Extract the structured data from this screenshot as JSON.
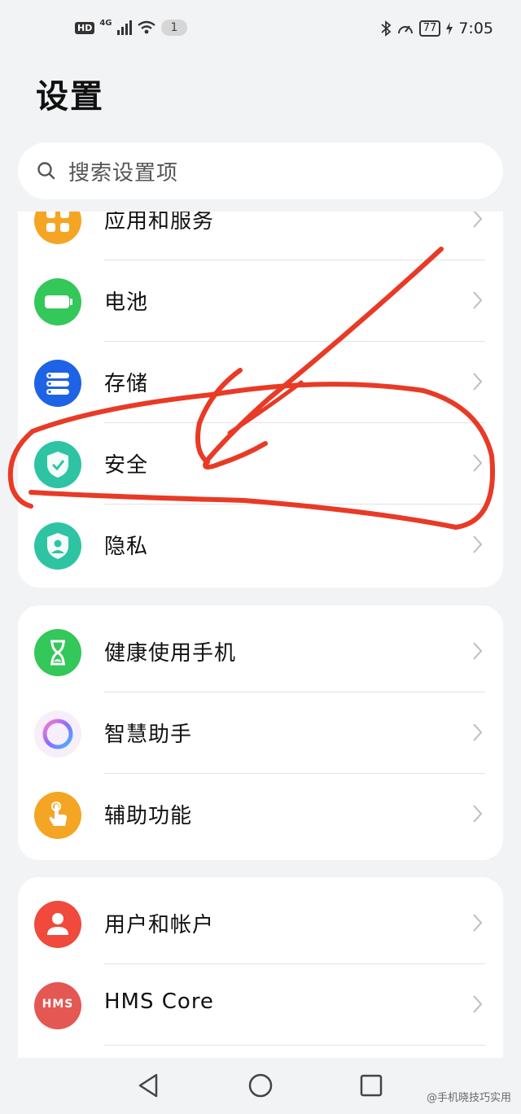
{
  "status_bar": {
    "hd": "HD",
    "network": "4G",
    "notification_count": "1",
    "battery": "77",
    "time": "7:05",
    "icons": [
      "signal-icon",
      "wifi-icon",
      "bluetooth-icon",
      "speed-icon",
      "battery-icon",
      "charging-icon"
    ]
  },
  "header": {
    "title": "设置"
  },
  "search": {
    "placeholder": "搜索设置项"
  },
  "groups": [
    {
      "items": [
        {
          "label": "应用和服务",
          "icon": "apps-icon",
          "color": "#f5a524"
        },
        {
          "label": "电池",
          "icon": "battery-icon",
          "color": "#34c759"
        },
        {
          "label": "存储",
          "icon": "storage-icon",
          "color": "#1e63e6"
        },
        {
          "label": "安全",
          "icon": "shield-icon",
          "color": "#2ec4a3"
        },
        {
          "label": "隐私",
          "icon": "privacy-icon",
          "color": "#2ec4a3"
        }
      ]
    },
    {
      "items": [
        {
          "label": "健康使用手机",
          "icon": "hourglass-icon",
          "color": "#34c759"
        },
        {
          "label": "智慧助手",
          "icon": "assistant-icon",
          "color": "#b86cf3"
        },
        {
          "label": "辅助功能",
          "icon": "hand-icon",
          "color": "#f5a524"
        }
      ]
    },
    {
      "items": [
        {
          "label": "用户和帐户",
          "icon": "user-icon",
          "color": "#ef4a3c"
        },
        {
          "label": "HMS Core",
          "icon": "hms-icon",
          "icon_text": "HMS",
          "color": "#e45753"
        }
      ]
    }
  ],
  "nav_bar": {
    "buttons": [
      "back-icon",
      "home-icon",
      "recents-icon"
    ]
  },
  "watermark": "@手机晓技巧实用",
  "annotation_color": "#e83a26"
}
